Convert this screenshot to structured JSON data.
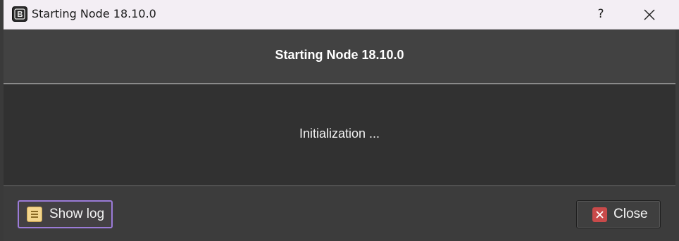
{
  "window": {
    "title": "Starting Node 18.10.0",
    "help_label": "?",
    "app_icon": "b-logo-icon",
    "close_icon": "close-icon"
  },
  "header": {
    "title": "Starting Node 18.10.0"
  },
  "content": {
    "status": "Initialization ..."
  },
  "footer": {
    "show_log_label": "Show log",
    "show_log_icon": "log-icon",
    "close_label": "Close",
    "close_icon": "close-red-icon"
  },
  "colors": {
    "accent_border": "#9b7bd8",
    "close_icon_bg": "#c94a4a",
    "log_icon_bg": "#f3d58e"
  }
}
